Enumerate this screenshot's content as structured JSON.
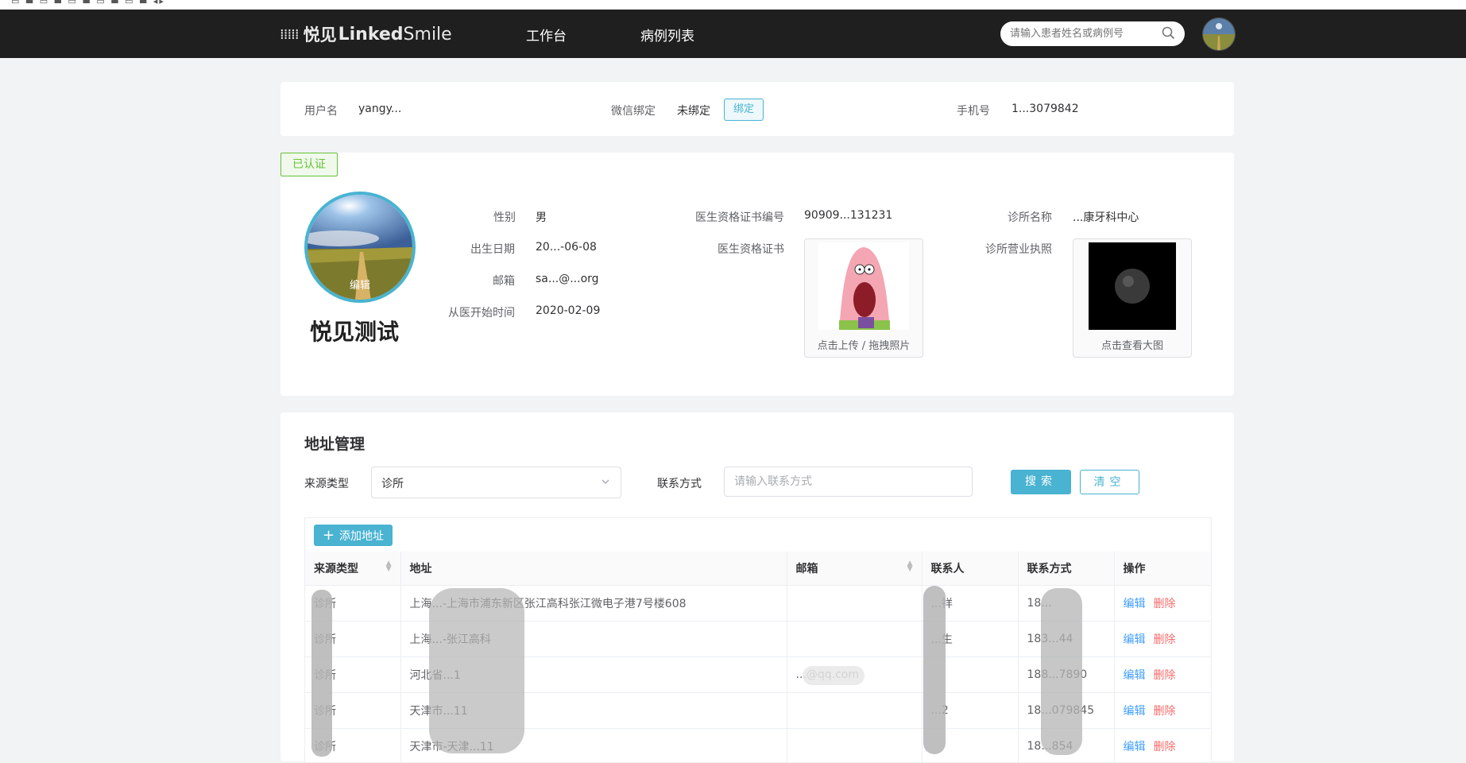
{
  "header": {
    "logo_cn": "悦见",
    "logo_en_bold": "Linked",
    "logo_en_rest": "Smile",
    "nav": [
      "工作台",
      "病例列表"
    ],
    "search_placeholder": "请输入患者姓名或病例号"
  },
  "account": {
    "username_label": "用户名",
    "username_value": "yangy...",
    "wechat_label": "微信绑定",
    "wechat_value": "未绑定",
    "bind_button": "绑定",
    "phone_label": "手机号",
    "phone_value": "1...3079842"
  },
  "profile": {
    "verified_badge": "已认证",
    "avatar_edit": "编辑",
    "name": "悦见测试",
    "gender_label": "性别",
    "gender_value": "男",
    "birth_label": "出生日期",
    "birth_value": "20...-06-08",
    "email_label": "邮箱",
    "email_value": "sa...@...org",
    "practice_start_label": "从医开始时间",
    "practice_start_value": "2020-02-09",
    "cert_no_label": "医生资格证书编号",
    "cert_no_value": "90909...131231",
    "cert_label": "医生资格证书",
    "cert_caption": "点击上传 / 拖拽照片",
    "clinic_name_label": "诊所名称",
    "clinic_name_value": "...康牙科中心",
    "license_label": "诊所营业执照",
    "license_caption": "点击查看大图"
  },
  "address": {
    "title": "地址管理",
    "source_label": "来源类型",
    "source_selected": "诊所",
    "contact_label": "联系方式",
    "contact_placeholder": "请输入联系方式",
    "search_button": "搜索",
    "clear_button": "清空",
    "add_button": "添加地址",
    "columns": [
      "来源类型",
      "地址",
      "邮箱",
      "联系人",
      "联系方式",
      "操作"
    ],
    "edit_label": "编辑",
    "delete_label": "删除",
    "rows": [
      {
        "source": "诊所",
        "address": "上海...-上海市浦东新区张江高科张江微电子港7号楼608",
        "email": "",
        "contact": "...祥",
        "phone": "18..."
      },
      {
        "source": "诊所",
        "address": "上海...-张江高科",
        "email": "",
        "contact": "...生",
        "phone": "183...44"
      },
      {
        "source": "诊所",
        "address": "河北省...1",
        "email": "...@qq.com",
        "contact": "",
        "phone": "188...7890"
      },
      {
        "source": "诊所",
        "address": "天津市...11",
        "email": "",
        "contact": "...2",
        "phone": "18...079845"
      },
      {
        "source": "诊所",
        "address": "天津市-天津...11",
        "email": "",
        "contact": "",
        "phone": "18...854"
      }
    ]
  },
  "colors": {
    "accent": "#49b3d1",
    "topbar": "#1f1f1f",
    "verified": "#67c23a",
    "delete": "#f56c6c",
    "edit": "#409eff"
  }
}
